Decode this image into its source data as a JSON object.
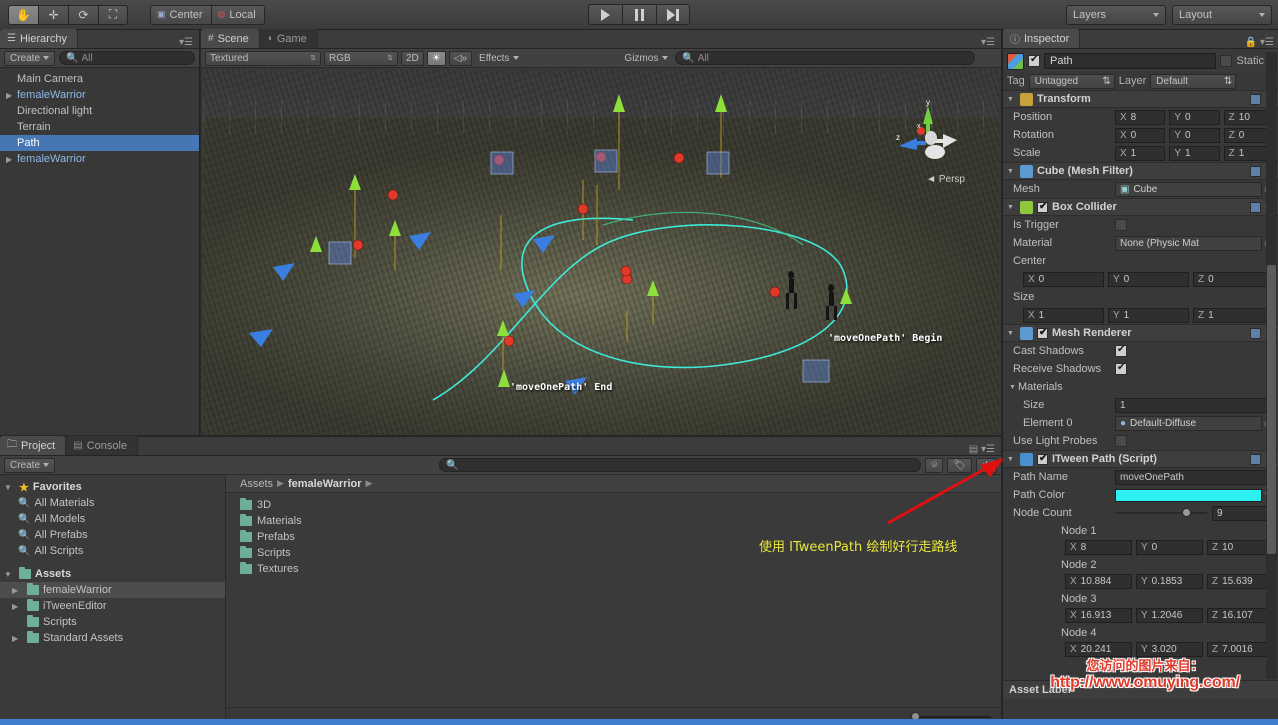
{
  "toolbar": {
    "tools": [
      {
        "name": "hand-tool",
        "glyph": "✋",
        "active": true
      },
      {
        "name": "move-tool",
        "glyph": "✛",
        "active": false
      },
      {
        "name": "rotate-tool",
        "glyph": "⟳",
        "active": false
      },
      {
        "name": "scale-tool",
        "glyph": "⤢",
        "active": false
      }
    ],
    "pivot_label": "Center",
    "space_label": "Local",
    "play_label": "play",
    "pause_label": "pause",
    "step_label": "step",
    "layers_label": "Layers",
    "layout_label": "Layout"
  },
  "hierarchy": {
    "tab_label": "Hierarchy",
    "create_label": "Create",
    "search_placeholder": "All",
    "items": [
      {
        "label": "Main Camera",
        "expandable": false,
        "prefab": false,
        "selected": false
      },
      {
        "label": "femaleWarrior",
        "expandable": true,
        "prefab": true,
        "selected": false
      },
      {
        "label": "Directional light",
        "expandable": false,
        "prefab": false,
        "selected": false
      },
      {
        "label": "Terrain",
        "expandable": false,
        "prefab": false,
        "selected": false
      },
      {
        "label": "Path",
        "expandable": false,
        "prefab": false,
        "selected": true
      },
      {
        "label": "femaleWarrior",
        "expandable": true,
        "prefab": true,
        "selected": false
      }
    ]
  },
  "scene": {
    "tabs": [
      {
        "label": "Scene",
        "active": true
      },
      {
        "label": "Game",
        "active": false
      }
    ],
    "draw_mode": "Textured",
    "color_mode": "RGB",
    "mode_2d": "2D",
    "lighting_icon": "sun-icon",
    "audio_icon": "audio-icon",
    "effects_label": "Effects",
    "gizmos_label": "Gizmos",
    "search_placeholder": "All",
    "label_begin": "'moveOnePath' Begin",
    "label_end": "'moveOnePath' End",
    "persp_label": "Persp",
    "axis_x": "x",
    "axis_y": "y",
    "axis_z": "z"
  },
  "project": {
    "tabs": [
      {
        "label": "Project",
        "active": true
      },
      {
        "label": "Console",
        "active": false
      }
    ],
    "create_label": "Create",
    "favorites_label": "Favorites",
    "favorites": [
      "All Materials",
      "All Models",
      "All Prefabs",
      "All Scripts"
    ],
    "assets_label": "Assets",
    "assets_tree": [
      {
        "label": "femaleWarrior",
        "expandable": true,
        "selected": true
      },
      {
        "label": "iTweenEditor",
        "expandable": true,
        "selected": false
      },
      {
        "label": "Scripts",
        "expandable": false,
        "selected": false
      },
      {
        "label": "Standard Assets",
        "expandable": true,
        "selected": false
      }
    ],
    "breadcrumb": [
      "Assets",
      "femaleWarrior"
    ],
    "folders": [
      "3D",
      "Materials",
      "Prefabs",
      "Scripts",
      "Textures"
    ]
  },
  "inspector": {
    "tab_label": "Inspector",
    "object_name": "Path",
    "object_enabled": true,
    "static_label": "Static",
    "tag_label": "Tag",
    "tag_value": "Untagged",
    "layer_label": "Layer",
    "layer_value": "Default",
    "transform": {
      "title": "Transform",
      "rows": [
        {
          "label": "Position",
          "x": "8",
          "y": "0",
          "z": "10"
        },
        {
          "label": "Rotation",
          "x": "0",
          "y": "0",
          "z": "0"
        },
        {
          "label": "Scale",
          "x": "1",
          "y": "1",
          "z": "1"
        }
      ]
    },
    "mesh_filter": {
      "title": "Cube (Mesh Filter)",
      "mesh_label": "Mesh",
      "mesh_value": "Cube"
    },
    "box_collider": {
      "title": "Box Collider",
      "enabled": true,
      "is_trigger_label": "Is Trigger",
      "is_trigger_checked": false,
      "material_label": "Material",
      "material_value": "None (Physic Mat",
      "center_label": "Center",
      "center": {
        "x": "0",
        "y": "0",
        "z": "0"
      },
      "size_label": "Size",
      "size": {
        "x": "1",
        "y": "1",
        "z": "1"
      }
    },
    "mesh_renderer": {
      "title": "Mesh Renderer",
      "enabled": true,
      "cast_shadows_label": "Cast Shadows",
      "cast_shadows_checked": true,
      "receive_shadows_label": "Receive Shadows",
      "receive_shadows_checked": true,
      "materials_label": "Materials",
      "size_label": "Size",
      "size_value": "1",
      "element_label": "Element 0",
      "element_value": "Default-Diffuse",
      "light_probes_label": "Use Light Probes",
      "light_probes_checked": false
    },
    "itween_path": {
      "title": "ITween Path (Script)",
      "enabled": true,
      "path_name_label": "Path Name",
      "path_name_value": "moveOnePath",
      "path_color_label": "Path Color",
      "path_color_value": "#2ff0f0",
      "node_count_label": "Node Count",
      "node_count_value": "9",
      "nodes": [
        {
          "label": "Node 1",
          "x": "8",
          "y": "0",
          "z": "10"
        },
        {
          "label": "Node 2",
          "x": "10.884",
          "y": "0.1853",
          "z": "15.639"
        },
        {
          "label": "Node 3",
          "x": "16.913",
          "y": "1.2046",
          "z": "16.107"
        },
        {
          "label": "Node 4",
          "x": "20.241",
          "y": "3.020",
          "z": "7.0016"
        }
      ]
    },
    "asset_label_title": "Asset Label"
  },
  "annotation": {
    "text": "使用 ITweenPath 绘制好行走路线",
    "color": "#e8e83c",
    "arrow_color": "#e01010"
  },
  "watermark": {
    "line1": "您访问的图片来自：",
    "line2": "http://www.omuying.com/",
    "color": "#e03a2a"
  }
}
